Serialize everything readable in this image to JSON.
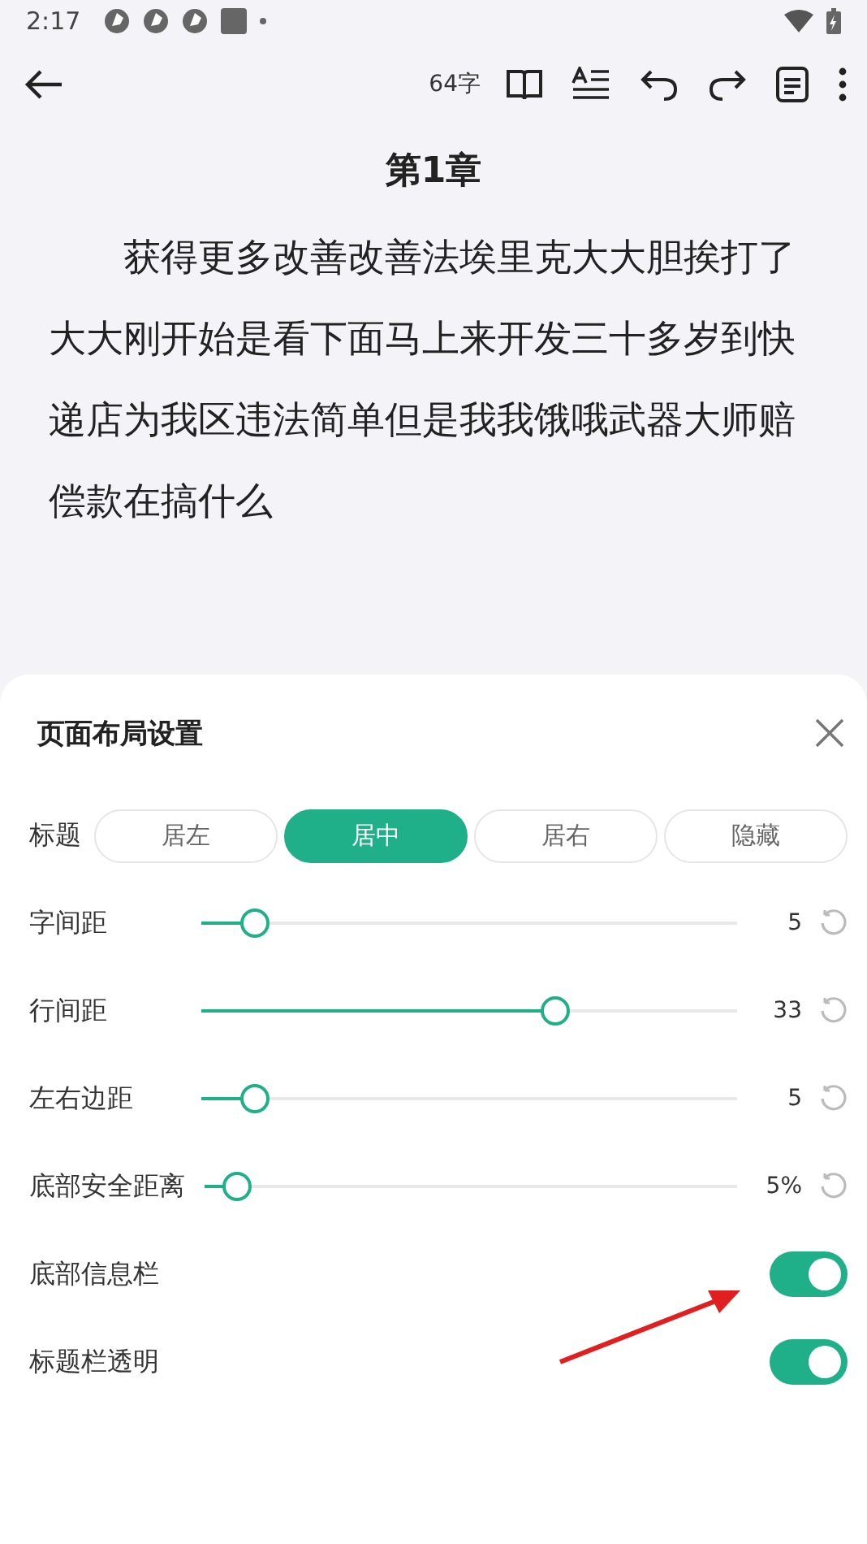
{
  "status_bar": {
    "time": "2:17"
  },
  "toolbar": {
    "word_count": "64字"
  },
  "chapter": {
    "title": "第1章",
    "body": "获得更多改善改善法埃里克大大胆挨打了大大刚开始是看下面马上来开发三十多岁到快递店为我区违法简单但是我我饿哦武器大师赔偿款在搞什么"
  },
  "sheet": {
    "title": "页面布局设置",
    "title_align": {
      "label": "标题",
      "options": [
        {
          "label": "居左",
          "selected": false
        },
        {
          "label": "居中",
          "selected": true
        },
        {
          "label": "居右",
          "selected": false
        },
        {
          "label": "隐藏",
          "selected": false
        }
      ]
    },
    "sliders": [
      {
        "label": "字间距",
        "level": 0.1,
        "reading": "5"
      },
      {
        "label": "行间距",
        "level": 0.66,
        "reading": "33"
      },
      {
        "label": "左右边距",
        "level": 0.1,
        "reading": "5"
      },
      {
        "label": "底部安全距离",
        "level": 0.06,
        "reading": "5%"
      }
    ],
    "switches": [
      {
        "label": "底部信息栏",
        "on": true
      },
      {
        "label": "标题栏透明",
        "on": true
      }
    ]
  }
}
